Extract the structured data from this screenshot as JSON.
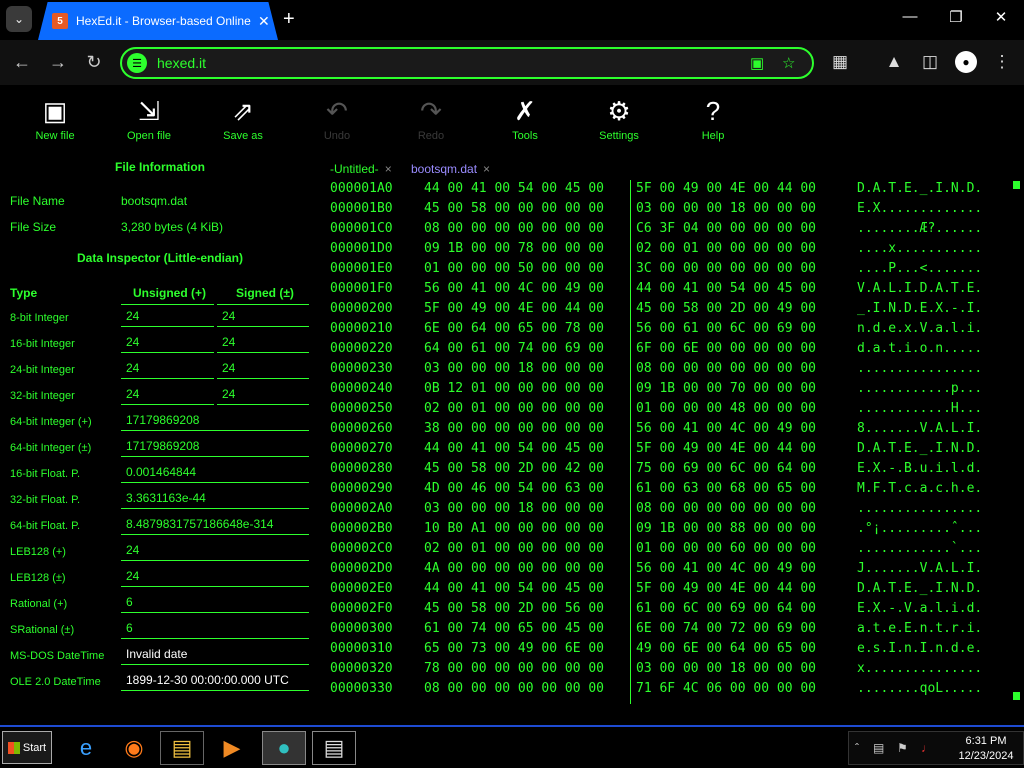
{
  "browser": {
    "tab_title": "HexEd.it - Browser-based Online a",
    "url": "hexed.it",
    "new_tab": "+",
    "favicon": "hexed-logo-icon"
  },
  "app_toolbar": [
    {
      "label": "New file",
      "icon": "new-file-icon",
      "enabled": true
    },
    {
      "label": "Open file",
      "icon": "open-file-icon",
      "enabled": true
    },
    {
      "label": "Save as",
      "icon": "save-as-icon",
      "enabled": true
    },
    {
      "label": "Undo",
      "icon": "undo-icon",
      "enabled": false
    },
    {
      "label": "Redo",
      "icon": "redo-icon",
      "enabled": false
    },
    {
      "label": "Tools",
      "icon": "tools-icon",
      "enabled": true
    },
    {
      "label": "Settings",
      "icon": "gear-icon",
      "enabled": true
    },
    {
      "label": "Help",
      "icon": "help-icon",
      "enabled": true
    }
  ],
  "file_info": {
    "title": "File Information",
    "name_label": "File Name",
    "name_value": "bootsqm.dat",
    "size_label": "File Size",
    "size_value": "3,280 bytes (4 KiB)"
  },
  "data_inspector": {
    "title": "Data Inspector (Little-endian)",
    "col_type": "Type",
    "col_unsigned": "Unsigned (+)",
    "col_signed": "Signed (±)",
    "rows": [
      {
        "type": "8-bit Integer",
        "unsigned": "24",
        "signed": "24"
      },
      {
        "type": "16-bit Integer",
        "unsigned": "24",
        "signed": "24"
      },
      {
        "type": "24-bit Integer",
        "unsigned": "24",
        "signed": "24"
      },
      {
        "type": "32-bit Integer",
        "unsigned": "24",
        "signed": "24"
      },
      {
        "type": "64-bit Integer (+)",
        "value": "17179869208"
      },
      {
        "type": "64-bit Integer (±)",
        "value": "17179869208"
      },
      {
        "type": "16-bit Float. P.",
        "value": "0.001464844"
      },
      {
        "type": "32-bit Float. P.",
        "value": "3.3631163e-44"
      },
      {
        "type": "64-bit Float. P.",
        "value": "8.4879831757186648e-314"
      },
      {
        "type": "LEB128 (+)",
        "value": "24"
      },
      {
        "type": "LEB128 (±)",
        "value": "24"
      },
      {
        "type": "Rational (+)",
        "value": "6"
      },
      {
        "type": "SRational (±)",
        "value": "6"
      },
      {
        "type": "MS-DOS DateTime",
        "value": "Invalid date"
      },
      {
        "type": "OLE 2.0 DateTime",
        "value": "1899-12-30 00:00:00.000 UTC"
      }
    ]
  },
  "file_tabs": [
    {
      "label": "-Untitled-",
      "close": "×",
      "active": false
    },
    {
      "label": "bootsqm.dat",
      "close": "×",
      "active": true
    }
  ],
  "hex_rows": [
    {
      "offset": "000001A0",
      "b1": "44 00 41 00 54 00 45 00",
      "b2": "5F 00 49 00 4E 00 44 00",
      "ascii": "D.A.T.E._.I.N.D."
    },
    {
      "offset": "000001B0",
      "b1": "45 00 58 00 00 00 00 00",
      "b2": "03 00 00 00 18 00 00 00",
      "ascii": "E.X............."
    },
    {
      "offset": "000001C0",
      "b1": "08 00 00 00 00 00 00 00",
      "b2": "C6 3F 04 00 00 00 00 00",
      "ascii": "........Æ?......"
    },
    {
      "offset": "000001D0",
      "b1": "09 1B 00 00 78 00 00 00",
      "b2": "02 00 01 00 00 00 00 00",
      "ascii": "....x..........."
    },
    {
      "offset": "000001E0",
      "b1": "01 00 00 00 50 00 00 00",
      "b2": "3C 00 00 00 00 00 00 00",
      "ascii": "....P...<......."
    },
    {
      "offset": "000001F0",
      "b1": "56 00 41 00 4C 00 49 00",
      "b2": "44 00 41 00 54 00 45 00",
      "ascii": "V.A.L.I.D.A.T.E."
    },
    {
      "offset": "00000200",
      "b1": "5F 00 49 00 4E 00 44 00",
      "b2": "45 00 58 00 2D 00 49 00",
      "ascii": "_.I.N.D.E.X.-.I."
    },
    {
      "offset": "00000210",
      "b1": "6E 00 64 00 65 00 78 00",
      "b2": "56 00 61 00 6C 00 69 00",
      "ascii": "n.d.e.x.V.a.l.i."
    },
    {
      "offset": "00000220",
      "b1": "64 00 61 00 74 00 69 00",
      "b2": "6F 00 6E 00 00 00 00 00",
      "ascii": "d.a.t.i.o.n....."
    },
    {
      "offset": "00000230",
      "b1": "03 00 00 00 18 00 00 00",
      "b2": "08 00 00 00 00 00 00 00",
      "ascii": "................"
    },
    {
      "offset": "00000240",
      "b1": "0B 12 01 00 00 00 00 00",
      "b2": "09 1B 00 00 70 00 00 00",
      "ascii": "............p..."
    },
    {
      "offset": "00000250",
      "b1": "02 00 01 00 00 00 00 00",
      "b2": "01 00 00 00 48 00 00 00",
      "ascii": "............H..."
    },
    {
      "offset": "00000260",
      "b1": "38 00 00 00 00 00 00 00",
      "b2": "56 00 41 00 4C 00 49 00",
      "ascii": "8.......V.A.L.I."
    },
    {
      "offset": "00000270",
      "b1": "44 00 41 00 54 00 45 00",
      "b2": "5F 00 49 00 4E 00 44 00",
      "ascii": "D.A.T.E._.I.N.D."
    },
    {
      "offset": "00000280",
      "b1": "45 00 58 00 2D 00 42 00",
      "b2": "75 00 69 00 6C 00 64 00",
      "ascii": "E.X.-.B.u.i.l.d."
    },
    {
      "offset": "00000290",
      "b1": "4D 00 46 00 54 00 63 00",
      "b2": "61 00 63 00 68 00 65 00",
      "ascii": "M.F.T.c.a.c.h.e."
    },
    {
      "offset": "000002A0",
      "b1": "03 00 00 00 18 00 00 00",
      "b2": "08 00 00 00 00 00 00 00",
      "ascii": "................"
    },
    {
      "offset": "000002B0",
      "b1": "10 B0 A1 00 00 00 00 00",
      "b2": "09 1B 00 00 88 00 00 00",
      "ascii": ".°¡.........ˆ..."
    },
    {
      "offset": "000002C0",
      "b1": "02 00 01 00 00 00 00 00",
      "b2": "01 00 00 00 60 00 00 00",
      "ascii": "............`..."
    },
    {
      "offset": "000002D0",
      "b1": "4A 00 00 00 00 00 00 00",
      "b2": "56 00 41 00 4C 00 49 00",
      "ascii": "J.......V.A.L.I."
    },
    {
      "offset": "000002E0",
      "b1": "44 00 41 00 54 00 45 00",
      "b2": "5F 00 49 00 4E 00 44 00",
      "ascii": "D.A.T.E._.I.N.D."
    },
    {
      "offset": "000002F0",
      "b1": "45 00 58 00 2D 00 56 00",
      "b2": "61 00 6C 00 69 00 64 00",
      "ascii": "E.X.-.V.a.l.i.d."
    },
    {
      "offset": "00000300",
      "b1": "61 00 74 00 65 00 45 00",
      "b2": "6E 00 74 00 72 00 69 00",
      "ascii": "a.t.e.E.n.t.r.i."
    },
    {
      "offset": "00000310",
      "b1": "65 00 73 00 49 00 6E 00",
      "b2": "49 00 6E 00 64 00 65 00",
      "ascii": "e.s.I.n.I.n.d.e."
    },
    {
      "offset": "00000320",
      "b1": "78 00 00 00 00 00 00 00",
      "b2": "03 00 00 00 18 00 00 00",
      "ascii": "x..............."
    },
    {
      "offset": "00000330",
      "b1": "08 00 00 00 00 00 00 00",
      "b2": "71 6F 4C 06 00 00 00 00",
      "ascii": "........qoL....."
    }
  ],
  "taskbar": {
    "start_label": "Start",
    "apps": [
      "internet-explorer-icon",
      "firefox-icon",
      "file-explorer-icon",
      "media-player-icon",
      "app-bubble-icon",
      "window-app-icon"
    ],
    "time": "6:31 PM",
    "date": "12/23/2024"
  },
  "colors": {
    "accent": "#2dff2d",
    "tab_blue": "#0b6bff",
    "taskbar_border": "#1e4bd2"
  }
}
